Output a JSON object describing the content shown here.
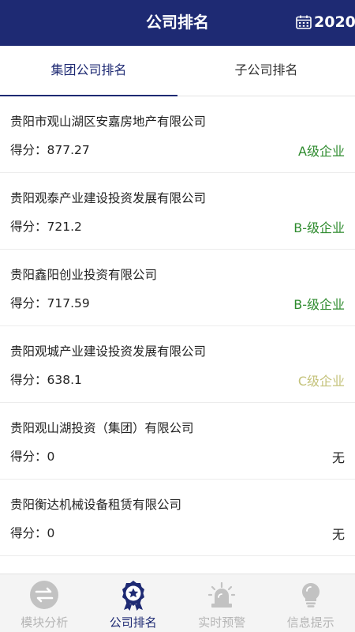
{
  "header": {
    "title": "公司排名",
    "year": "2020"
  },
  "tabs": [
    {
      "label": "集团公司排名",
      "active": true
    },
    {
      "label": "子公司排名",
      "active": false
    }
  ],
  "score_label": "得分：",
  "companies": [
    {
      "name": "贵阳市观山湖区安嘉房地产有限公司",
      "score": "877.27",
      "grade": "A级企业",
      "grade_color": "#2e8b2e"
    },
    {
      "name": "贵阳观泰产业建设投资发展有限公司",
      "score": "721.2",
      "grade": "B-级企业",
      "grade_color": "#2e8b2e"
    },
    {
      "name": "贵阳鑫阳创业投资有限公司",
      "score": "717.59",
      "grade": "B-级企业",
      "grade_color": "#2e8b2e"
    },
    {
      "name": "贵阳观城产业建设投资发展有限公司",
      "score": "638.1",
      "grade": "C级企业",
      "grade_color": "#c4c27a"
    },
    {
      "name": "贵阳观山湖投资（集团）有限公司",
      "score": "0",
      "grade": "无",
      "grade_color": "#222222"
    },
    {
      "name": "贵阳衡达机械设备租赁有限公司",
      "score": "0",
      "grade": "无",
      "grade_color": "#222222"
    }
  ],
  "bottom_nav": [
    {
      "label": "模块分析",
      "icon": "transfer-icon",
      "active": false
    },
    {
      "label": "公司排名",
      "icon": "rank-badge-icon",
      "active": true
    },
    {
      "label": "实时预警",
      "icon": "alarm-light-icon",
      "active": false
    },
    {
      "label": "信息提示",
      "icon": "lightbulb-icon",
      "active": false
    }
  ],
  "colors": {
    "primary": "#1e2a73",
    "inactive": "#b5b5b5"
  }
}
